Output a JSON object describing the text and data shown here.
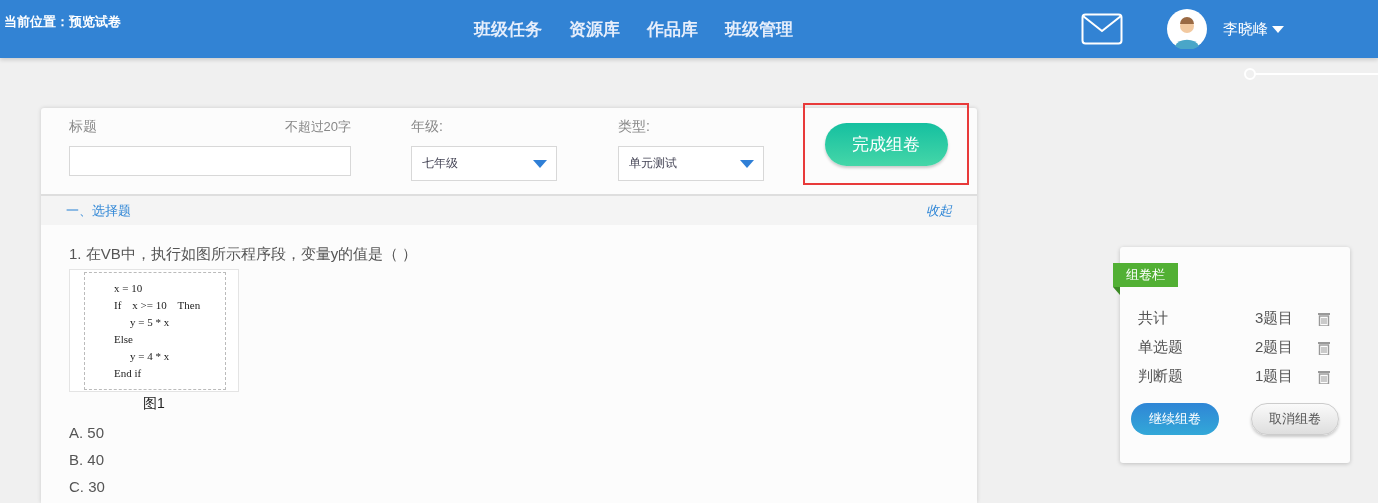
{
  "header": {
    "location": "当前位置：预览试卷",
    "nav": [
      {
        "label": "班级任务"
      },
      {
        "label": "资源库"
      },
      {
        "label": "作品库"
      },
      {
        "label": "班级管理"
      }
    ],
    "user": {
      "name": "李晓峰"
    }
  },
  "form": {
    "title_label": "标题",
    "title_hint": "不超过20字",
    "grade_label": "年级:",
    "grade_value": "七年级",
    "type_label": "类型:",
    "type_value": "单元测试",
    "finish_button": {
      "label": "完成组卷",
      "highlighted": true
    }
  },
  "section": {
    "heading": "一、选择题",
    "collapse_link": "收起"
  },
  "question": {
    "text": "1. 在VB中，执行如图所示程序段，变量y的值是（ ）",
    "figure_code": [
      {
        "text": "x = 10",
        "indent": false
      },
      {
        "text": "If    x >= 10    Then",
        "indent": false
      },
      {
        "text": "y = 5 * x",
        "indent": true
      },
      {
        "text": "Else",
        "indent": false
      },
      {
        "text": "y = 4 * x",
        "indent": true
      },
      {
        "text": "End if",
        "indent": false
      }
    ],
    "figure_caption": "图1",
    "options": [
      "A. 50",
      "B. 40",
      "C. 30"
    ]
  },
  "cart": {
    "tag": "组卷栏",
    "rows": [
      {
        "label": "共计",
        "count": "3题目"
      },
      {
        "label": "单选题",
        "count": "2题目"
      },
      {
        "label": "判断题",
        "count": "1题目"
      }
    ],
    "continue_button": "继续组卷",
    "cancel_button": "取消组卷"
  }
}
